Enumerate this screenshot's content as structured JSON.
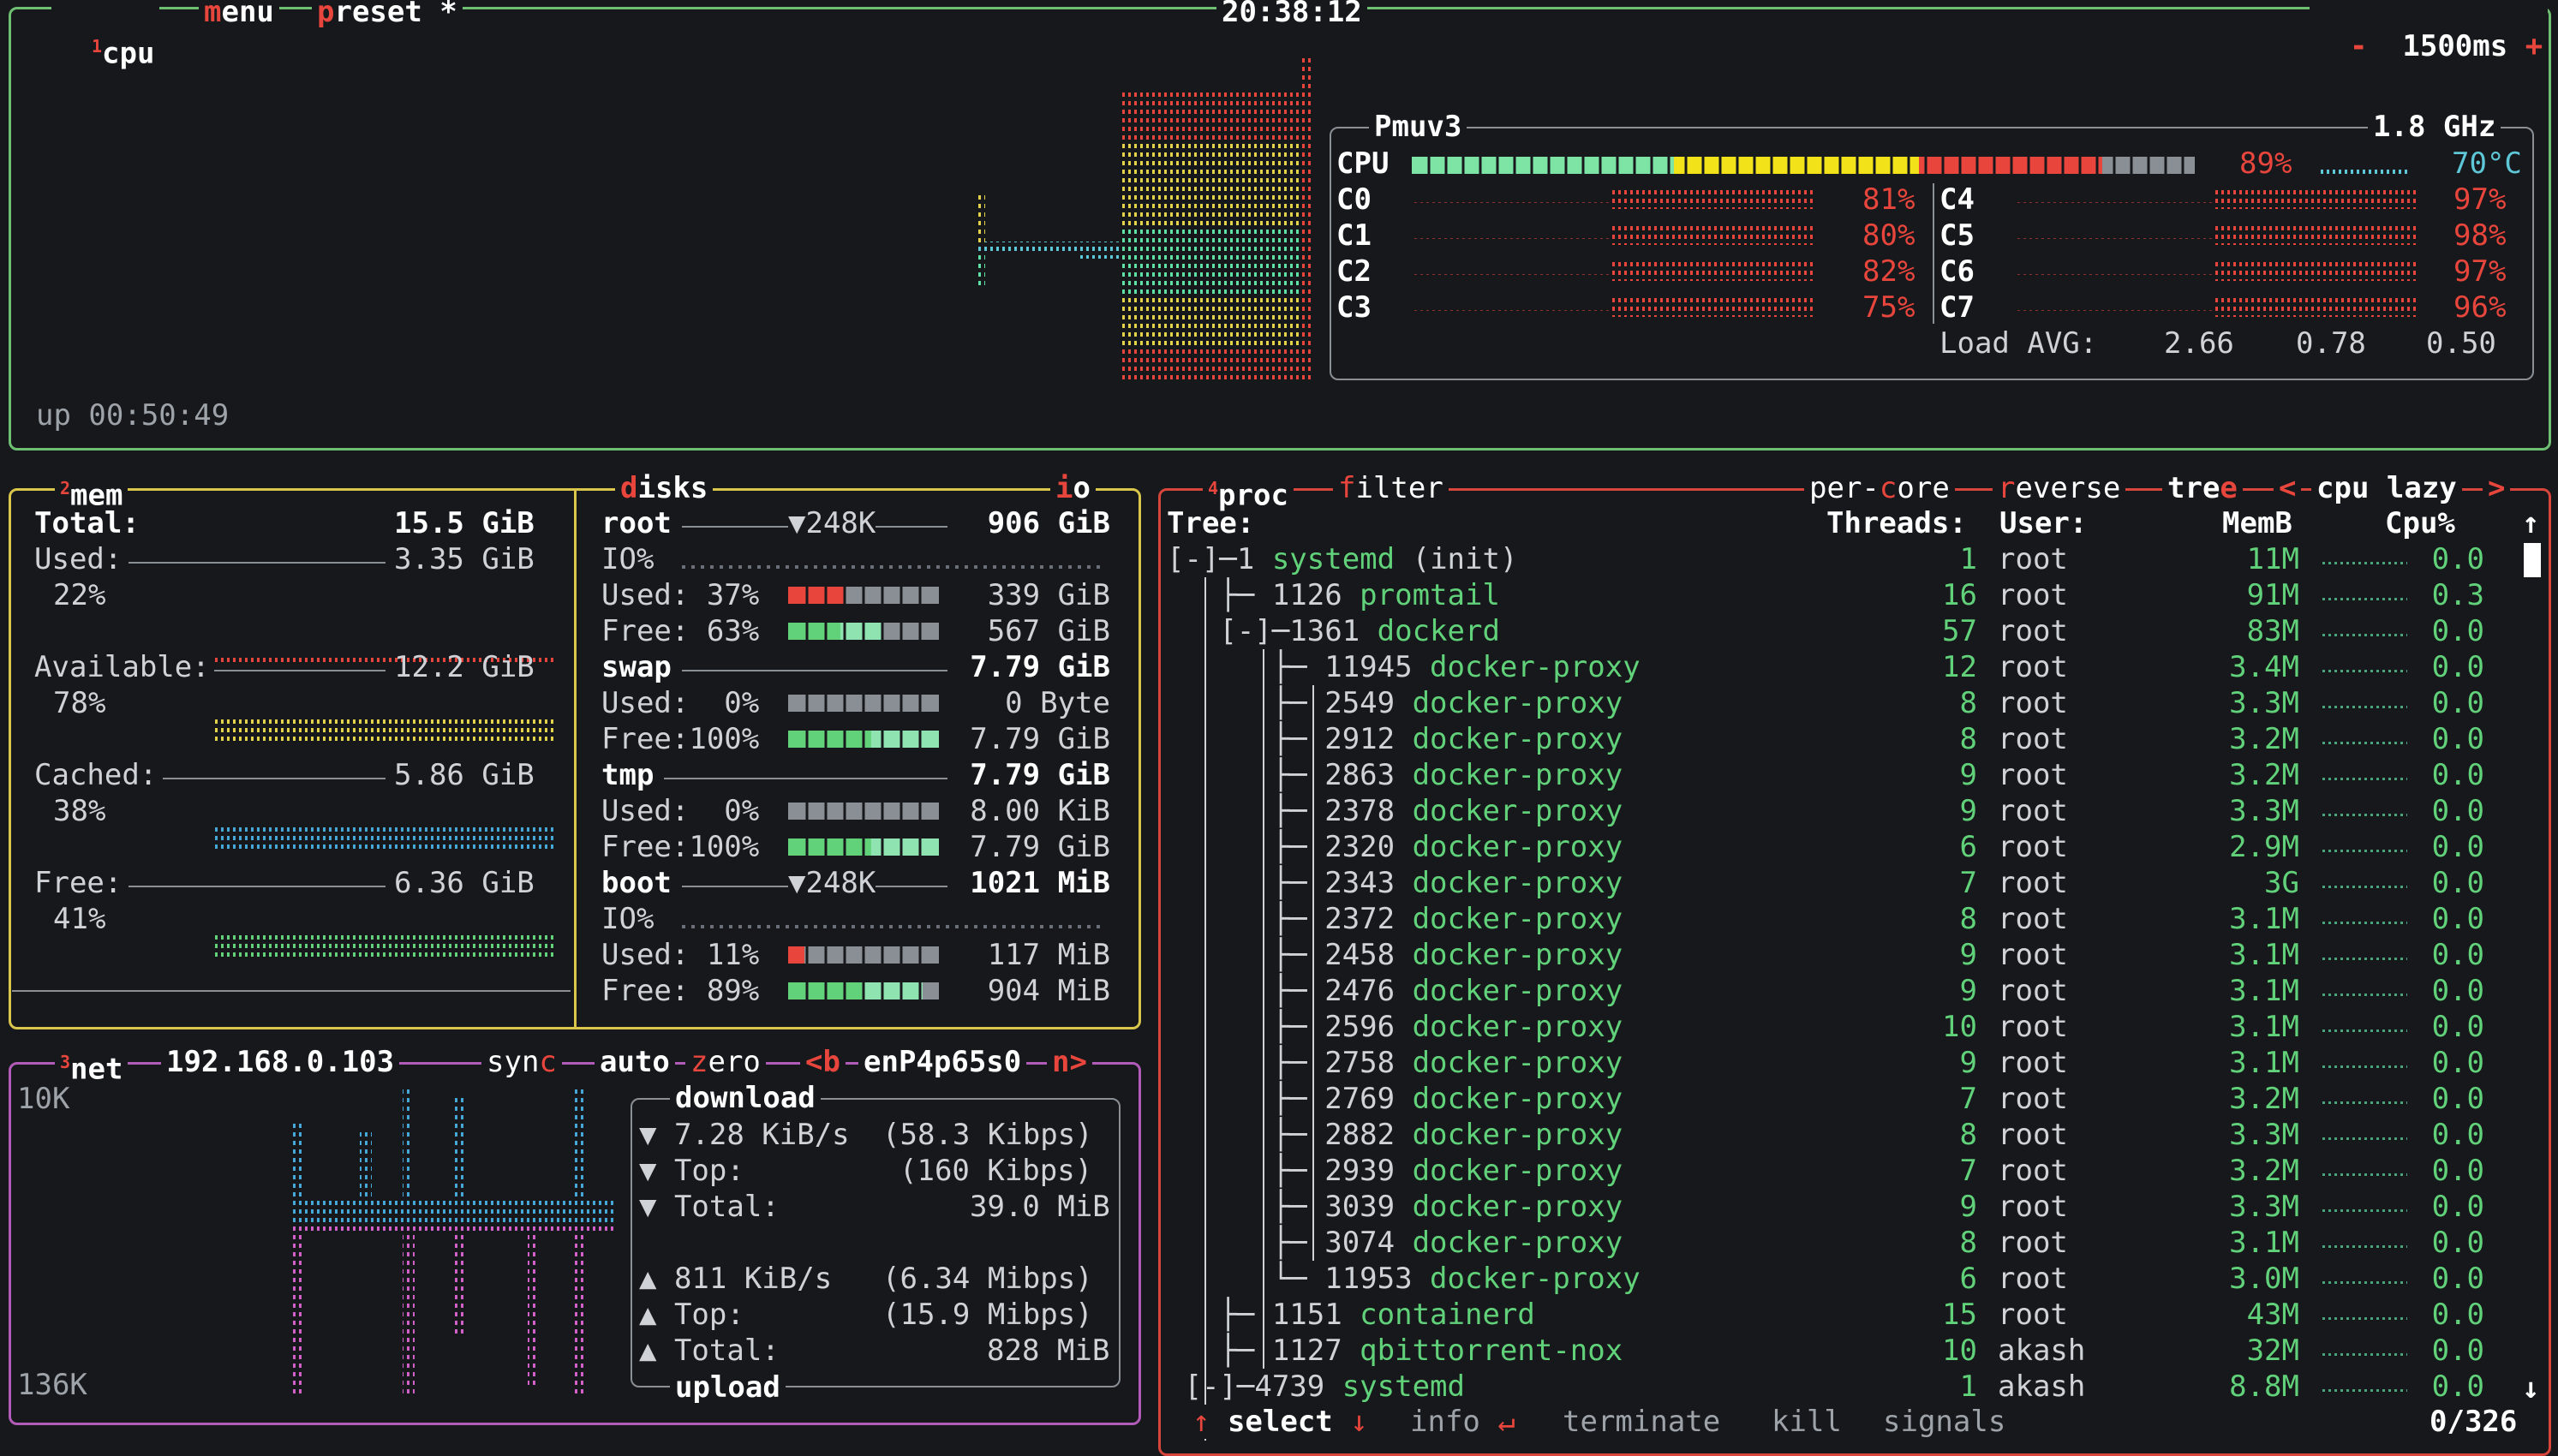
{
  "top": {
    "panel_num": "1",
    "cpu": "cpu",
    "menu": "menu",
    "preset": "preset *",
    "clock": "20:38:12",
    "minus": "-",
    "interval": "1500ms",
    "plus": "+",
    "uptime": "up 00:50:49"
  },
  "cpu_box": {
    "model": "Pmuv3",
    "freq": "1.8 GHz",
    "cpu_label": "CPU",
    "cpu_pct": "89%",
    "temp": "70°C",
    "load_label": "Load AVG:",
    "load": [
      "2.66",
      "0.78",
      "0.50"
    ],
    "cores": [
      {
        "name": "C0",
        "pct": "81%"
      },
      {
        "name": "C1",
        "pct": "80%"
      },
      {
        "name": "C2",
        "pct": "82%"
      },
      {
        "name": "C3",
        "pct": "75%"
      },
      {
        "name": "C4",
        "pct": "97%"
      },
      {
        "name": "C5",
        "pct": "98%"
      },
      {
        "name": "C6",
        "pct": "97%"
      },
      {
        "name": "C7",
        "pct": "96%"
      }
    ]
  },
  "mem": {
    "panel_num": "2",
    "title": "mem",
    "total_label": "Total:",
    "total": "15.5 GiB",
    "rows": [
      {
        "label": "Used:",
        "value": "3.35 GiB",
        "pct": "22%"
      },
      {
        "label": "Available:",
        "value": "12.2 GiB",
        "pct": "78%"
      },
      {
        "label": "Cached:",
        "value": "5.86 GiB",
        "pct": "38%"
      },
      {
        "label": "Free:",
        "value": "6.36 GiB",
        "pct": "41%"
      }
    ]
  },
  "disks": {
    "title": "disks",
    "io": "io",
    "root": {
      "name": "root",
      "io": "▼248K",
      "size": "906 GiB",
      "io_label": "IO%",
      "used": "Used: 37%",
      "used_v": "339 GiB",
      "free": "Free: 63%",
      "free_v": "567 GiB"
    },
    "swap": {
      "name": "swap",
      "size": "7.79 GiB",
      "used": "Used:  0%",
      "used_v": "0 Byte",
      "free": "Free:100%",
      "free_v": "7.79 GiB"
    },
    "tmp": {
      "name": "tmp",
      "size": "7.79 GiB",
      "used": "Used:  0%",
      "used_v": "8.00 KiB",
      "free": "Free:100%",
      "free_v": "7.79 GiB"
    },
    "boot": {
      "name": "boot",
      "io": "▼248K",
      "size": "1021 MiB",
      "io_label": "IO%",
      "used": "Used: 11%",
      "used_v": "117 MiB",
      "free": "Free: 89%",
      "free_v": "904 MiB"
    }
  },
  "net": {
    "panel_num": "3",
    "title": "net",
    "ip": "192.168.0.103",
    "sync": "sync",
    "auto": "auto",
    "zero": "zero",
    "prev": "<b",
    "iface": "enP4p65s0",
    "next": "n>",
    "scale_top": "10K",
    "scale_bottom": "136K",
    "download_label": "download",
    "upload_label": "upload",
    "down": {
      "rate": "▼ 7.28 KiB/s",
      "rate_b": "(58.3 Kibps)",
      "top": "▼ Top:",
      "top_v": "(160 Kibps)",
      "total": "▼ Total:",
      "total_v": "39.0 MiB"
    },
    "up": {
      "rate": "▲ 811 KiB/s",
      "rate_b": "(6.34 Mibps)",
      "top": "▲ Top:",
      "top_v": "(15.9 Mibps)",
      "total": "▲ Total:",
      "total_v": "828 MiB"
    }
  },
  "proc": {
    "panel_num": "4",
    "title": "proc",
    "filter": "filter",
    "per_core": "per-core",
    "reverse": "reverse",
    "tree": "tree",
    "lt": "<",
    "sort": "cpu lazy",
    "gt": ">",
    "headers": {
      "tree": "Tree:",
      "threads": "Threads:",
      "user": "User:",
      "mem": "MemB",
      "cpu": "Cpu%"
    },
    "rows": [
      {
        "prefix": "[-]─1 ",
        "name": "systemd",
        "args": " (init)",
        "threads": "1",
        "user": "root",
        "mem": "11M",
        "cpu": "0.0"
      },
      {
        "prefix": "   ├─ 1126 ",
        "name": "promtail",
        "args": "",
        "threads": "16",
        "user": "root",
        "mem": "91M",
        "cpu": "0.3"
      },
      {
        "prefix": "   [-]─1361 ",
        "name": "dockerd",
        "args": "",
        "threads": "57",
        "user": "root",
        "mem": "83M",
        "cpu": "0.0"
      },
      {
        "prefix": "      ├─ 11945 ",
        "name": "docker-proxy",
        "args": "",
        "threads": "12",
        "user": "root",
        "mem": "3.4M",
        "cpu": "0.0"
      },
      {
        "prefix": "      ├─ 2549 ",
        "name": "docker-proxy",
        "args": "",
        "threads": "8",
        "user": "root",
        "mem": "3.3M",
        "cpu": "0.0"
      },
      {
        "prefix": "      ├─ 2912 ",
        "name": "docker-proxy",
        "args": "",
        "threads": "8",
        "user": "root",
        "mem": "3.2M",
        "cpu": "0.0"
      },
      {
        "prefix": "      ├─ 2863 ",
        "name": "docker-proxy",
        "args": "",
        "threads": "9",
        "user": "root",
        "mem": "3.2M",
        "cpu": "0.0"
      },
      {
        "prefix": "      ├─ 2378 ",
        "name": "docker-proxy",
        "args": "",
        "threads": "9",
        "user": "root",
        "mem": "3.3M",
        "cpu": "0.0"
      },
      {
        "prefix": "      ├─ 2320 ",
        "name": "docker-proxy",
        "args": "",
        "threads": "6",
        "user": "root",
        "mem": "2.9M",
        "cpu": "0.0"
      },
      {
        "prefix": "      ├─ 2343 ",
        "name": "docker-proxy",
        "args": "",
        "threads": "7",
        "user": "root",
        "mem": "3G",
        "cpu": "0.0"
      },
      {
        "prefix": "      ├─ 2372 ",
        "name": "docker-proxy",
        "args": "",
        "threads": "8",
        "user": "root",
        "mem": "3.1M",
        "cpu": "0.0"
      },
      {
        "prefix": "      ├─ 2458 ",
        "name": "docker-proxy",
        "args": "",
        "threads": "9",
        "user": "root",
        "mem": "3.1M",
        "cpu": "0.0"
      },
      {
        "prefix": "      ├─ 2476 ",
        "name": "docker-proxy",
        "args": "",
        "threads": "9",
        "user": "root",
        "mem": "3.1M",
        "cpu": "0.0"
      },
      {
        "prefix": "      ├─ 2596 ",
        "name": "docker-proxy",
        "args": "",
        "threads": "10",
        "user": "root",
        "mem": "3.1M",
        "cpu": "0.0"
      },
      {
        "prefix": "      ├─ 2758 ",
        "name": "docker-proxy",
        "args": "",
        "threads": "9",
        "user": "root",
        "mem": "3.1M",
        "cpu": "0.0"
      },
      {
        "prefix": "      ├─ 2769 ",
        "name": "docker-proxy",
        "args": "",
        "threads": "7",
        "user": "root",
        "mem": "3.2M",
        "cpu": "0.0"
      },
      {
        "prefix": "      ├─ 2882 ",
        "name": "docker-proxy",
        "args": "",
        "threads": "8",
        "user": "root",
        "mem": "3.3M",
        "cpu": "0.0"
      },
      {
        "prefix": "      ├─ 2939 ",
        "name": "docker-proxy",
        "args": "",
        "threads": "7",
        "user": "root",
        "mem": "3.2M",
        "cpu": "0.0"
      },
      {
        "prefix": "      ├─ 3039 ",
        "name": "docker-proxy",
        "args": "",
        "threads": "9",
        "user": "root",
        "mem": "3.3M",
        "cpu": "0.0"
      },
      {
        "prefix": "      ├─ 3074 ",
        "name": "docker-proxy",
        "args": "",
        "threads": "8",
        "user": "root",
        "mem": "3.1M",
        "cpu": "0.0"
      },
      {
        "prefix": "      └─ 11953 ",
        "name": "docker-proxy",
        "args": "",
        "threads": "6",
        "user": "root",
        "mem": "3.0M",
        "cpu": "0.0"
      },
      {
        "prefix": "   ├─ 1151 ",
        "name": "containerd",
        "args": "",
        "threads": "15",
        "user": "root",
        "mem": "43M",
        "cpu": "0.0"
      },
      {
        "prefix": "   ├─ 1127 ",
        "name": "qbittorrent-nox",
        "args": "",
        "threads": "10",
        "user": "akash",
        "mem": "32M",
        "cpu": "0.0"
      },
      {
        "prefix": " [-]─4739 ",
        "name": "systemd",
        "args": "",
        "threads": "1",
        "user": "akash",
        "mem": "8.8M",
        "cpu": "0.0"
      }
    ],
    "footer": {
      "select": "↑ select ↓",
      "info": "info ↵",
      "terminate": "terminate",
      "kill": "kill",
      "signals": "signals",
      "count": "0/326"
    }
  },
  "colors": {
    "cpu_border": "#6fbf73",
    "mem_border": "#d9c64a",
    "net_border": "#b15cb8",
    "proc_border": "#d8453a",
    "accent": "#e8463c"
  }
}
